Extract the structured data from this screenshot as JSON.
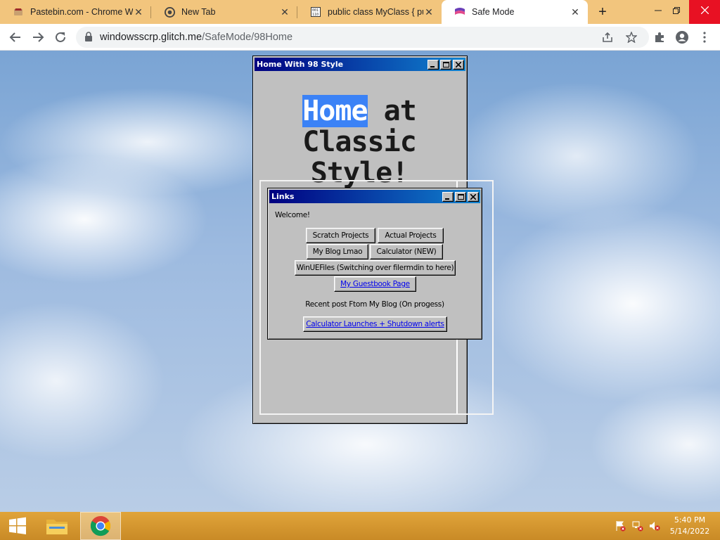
{
  "browser": {
    "tabs": [
      {
        "title": "Pastebin.com - Chrome Web",
        "icon": "pastebin-icon"
      },
      {
        "title": "New Tab",
        "icon": "chrome-icon"
      },
      {
        "title": "public class MyClass { publ",
        "icon": "code-icon"
      },
      {
        "title": "Safe Mode",
        "icon": "safemode-icon",
        "active": true
      }
    ],
    "new_tab_label": "+",
    "url_host": "windowsscrp.glitch.me",
    "url_path": "/SafeMode/98Home"
  },
  "home_window": {
    "title": "Home With 98 Style",
    "heading_highlight": "Home",
    "heading_line1_rest": " at",
    "heading_line2": "Classic Style!"
  },
  "links_window": {
    "title": "Links",
    "welcome": "Welcome!",
    "buttons": {
      "scratch": "Scratch Projects",
      "actual": "Actual Projects",
      "blog": "My Blog Lmao",
      "calculator": "Calculator (NEW)",
      "winuefiles": "WinUEFiles (Switching over filermdin to here)",
      "guestbook": "My Guestbook Page",
      "recent_post_link": "Calculator Launches + Shutdown alerts"
    },
    "recent_post_label": "Recent post Ftom My Blog (On progess)"
  },
  "taskbar": {
    "time": "5:40 PM",
    "date": "5/14/2022"
  },
  "colors": {
    "taskbar": "#d99a33",
    "tabstrip": "#f2c57d",
    "win98_title": "#000080",
    "highlight": "#3b82f6"
  }
}
